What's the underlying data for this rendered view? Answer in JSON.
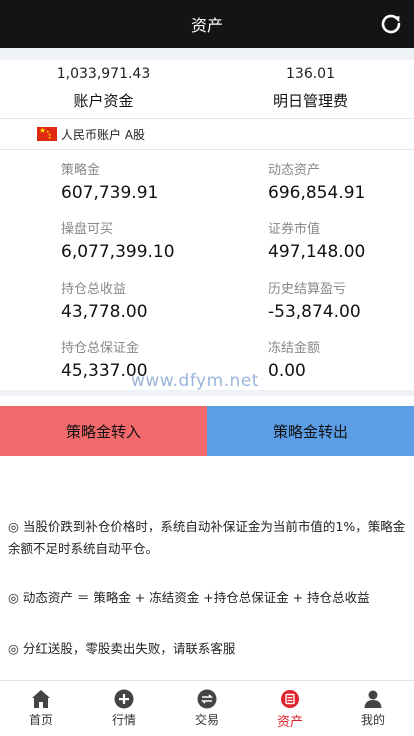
{
  "header": {
    "title": "资产",
    "refresh_icon": "refresh-icon"
  },
  "summary": {
    "account_funds_value": "1,033,971.43",
    "account_funds_label": "账户资金",
    "tomorrow_fee_value": "136.01",
    "tomorrow_fee_label": "明日管理费"
  },
  "account": {
    "flag_icon": "china-flag-icon",
    "label": "人民币账户 A股"
  },
  "stats": [
    {
      "label": "策略金",
      "value": "607,739.91"
    },
    {
      "label": "动态资产",
      "value": "696,854.91"
    },
    {
      "label": "操盘可买",
      "value": "6,077,399.10"
    },
    {
      "label": "证券市值",
      "value": "497,148.00"
    },
    {
      "label": "持仓总收益",
      "value": "43,778.00"
    },
    {
      "label": "历史结算盈亏",
      "value": "-53,874.00"
    },
    {
      "label": "持仓总保证金",
      "value": "45,337.00"
    },
    {
      "label": "冻结金额",
      "value": "0.00"
    }
  ],
  "watermark": "www.dfym.net",
  "actions": {
    "transfer_in": "策略金转入",
    "transfer_out": "策略金转出"
  },
  "notes": {
    "note1": "◎ 当股价跌到补仓价格时，系统自动补保证金为当前市值的1%，策略金余额不足时系统自动平仓。",
    "note2": "◎ 动态资产 ＝ 策略金 + 冻结资金 +持仓总保证金 + 持仓总收益",
    "note3": "◎ 分红送股，零股卖出失败，请联系客服"
  },
  "tabs": [
    {
      "label": "首页",
      "icon": "home-icon"
    },
    {
      "label": "行情",
      "icon": "plus-circle-icon"
    },
    {
      "label": "交易",
      "icon": "exchange-icon"
    },
    {
      "label": "资产",
      "icon": "wallet-icon"
    },
    {
      "label": "我的",
      "icon": "user-icon"
    }
  ],
  "colors": {
    "header_bg": "#141414",
    "transfer_in_bg": "#f2696b",
    "transfer_out_bg": "#5b9ee6",
    "active_tab": "#e0222a",
    "watermark": "#8aa8d6"
  }
}
